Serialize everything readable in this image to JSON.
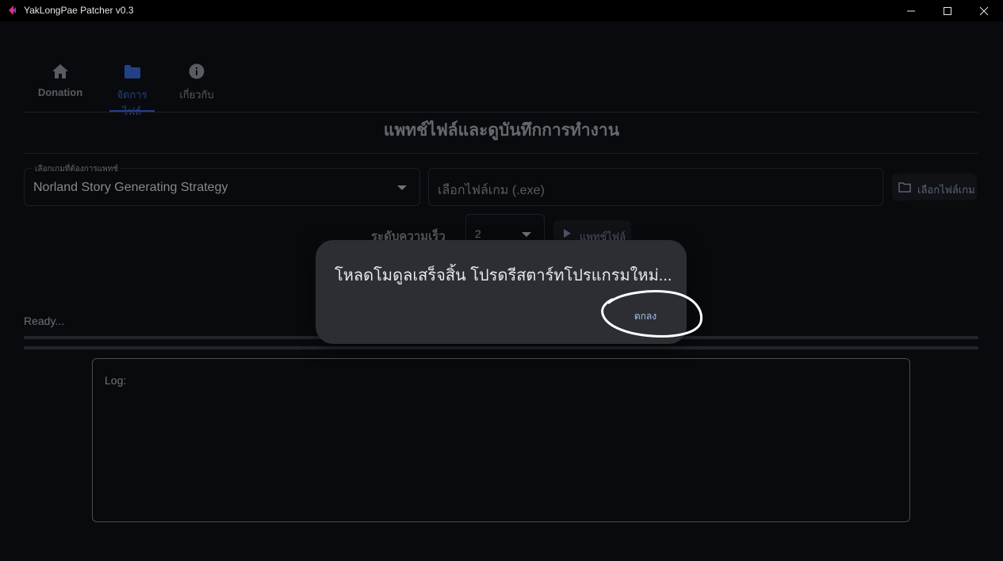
{
  "window": {
    "title": "YakLongPae Patcher v0.3"
  },
  "tabs": [
    {
      "label": "Donation",
      "icon": "home-icon"
    },
    {
      "label": "จัดการไฟล์",
      "icon": "folder-icon",
      "active": true
    },
    {
      "label": "เกี่ยวกับ",
      "icon": "info-icon"
    }
  ],
  "page": {
    "title": "แพทช์ไฟล์และดูบันทึกการทำงาน"
  },
  "game_select": {
    "label": "เลือกเกมที่ต้องการแพทช์",
    "value": "Norland Story Generating Strategy"
  },
  "file_input": {
    "placeholder": "เลือกไฟล์เกม (.exe)"
  },
  "pick_file_button": {
    "label": "เลือกไฟล์เกม"
  },
  "speed": {
    "label": "ระดับความเร็ว",
    "value": "2"
  },
  "patch_button": {
    "label": "แพทช์ไฟล์"
  },
  "status": {
    "text": "Ready..."
  },
  "log": {
    "label": "Log:"
  },
  "dialog": {
    "message": "โหลดโมดูลเสร็จสิ้น โปรดรีสตาร์ทโปรแกรมใหม่...",
    "ok_label": "ตกลง"
  },
  "colors": {
    "accent": "#2b4fa8",
    "dialog_bg": "#2c2e33",
    "ok_text": "#a8c0f0"
  }
}
